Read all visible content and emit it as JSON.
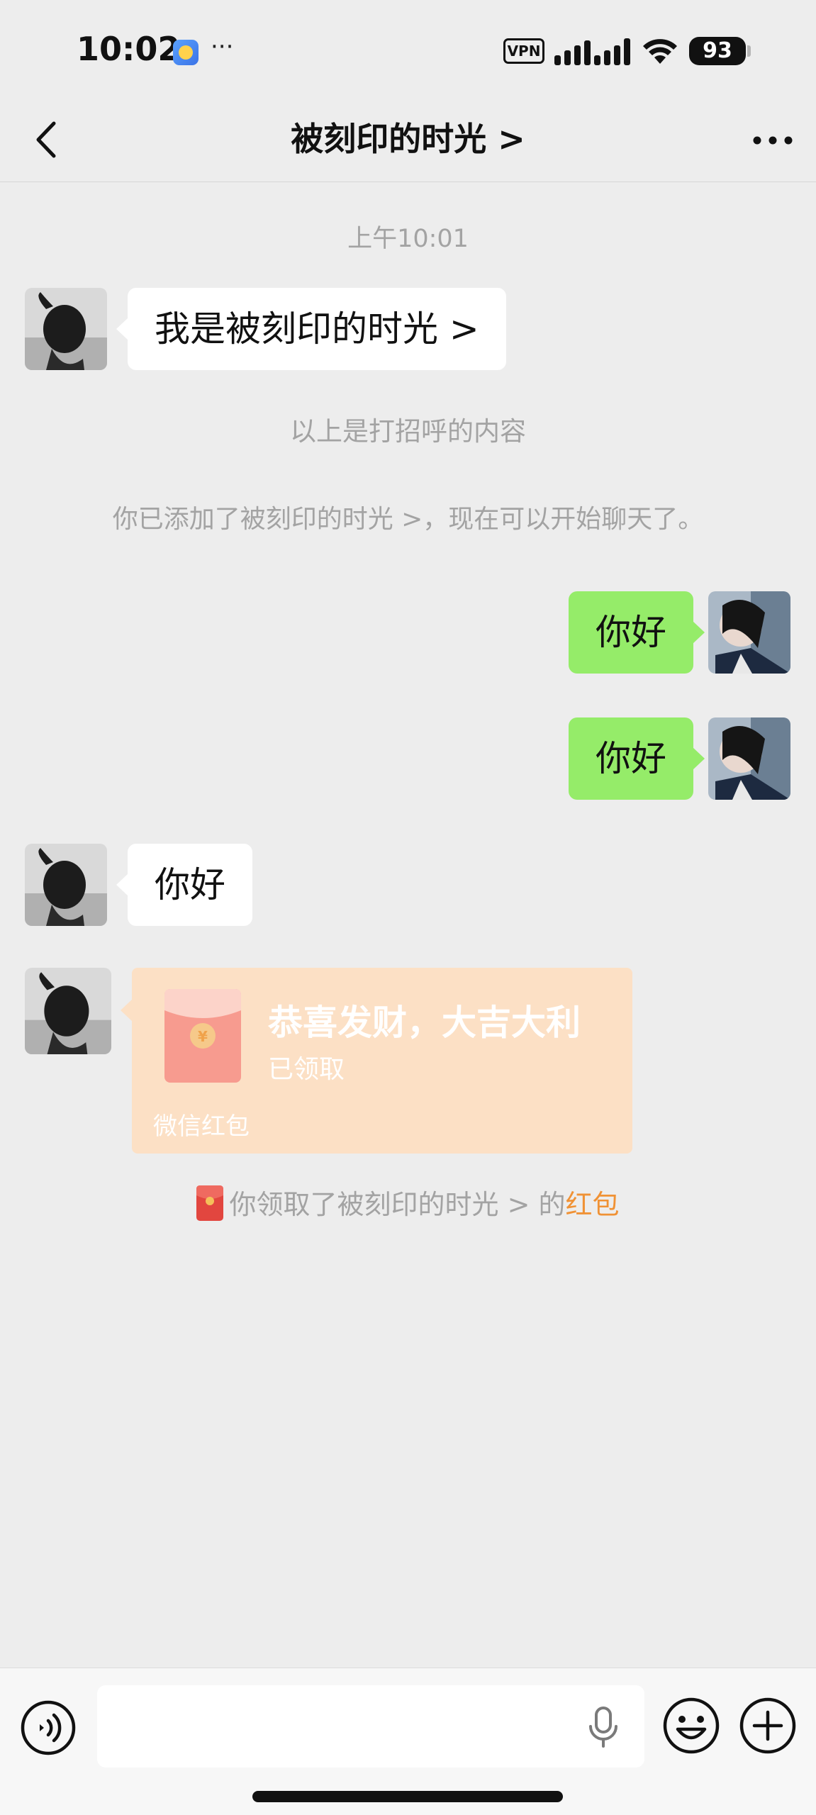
{
  "status_bar": {
    "time": "10:02",
    "dots": "···",
    "vpn": "VPN",
    "battery": "93",
    "icons": [
      "app-icon",
      "signal-icon",
      "wifi-icon",
      "battery-icon"
    ]
  },
  "nav": {
    "title": "被刻印的时光 >",
    "back_icon": "chevron-left-icon",
    "more_icon": "more-dots-icon"
  },
  "chat": {
    "timestamp": "上午10:01",
    "greeting_message": "我是被刻印的时光 >",
    "greeting_note": "以上是打招呼的内容",
    "added_note": "你已添加了被刻印的时光 >，现在可以开始聊天了。",
    "outgoing_1": "你好",
    "outgoing_2": "你好",
    "incoming_1": "你好",
    "red_packet": {
      "title": "恭喜发财，大吉大利",
      "status": "已领取",
      "footer": "微信红包"
    },
    "receive_notice": {
      "prefix": "你领取了被刻印的时光 > 的",
      "link": "红包"
    }
  },
  "input_bar": {
    "placeholder": "",
    "icons": [
      "voice-icon",
      "microphone-icon",
      "emoji-icon",
      "plus-icon"
    ]
  },
  "colors": {
    "background": "#ededed",
    "outgoing_bubble": "#95ec69",
    "incoming_bubble": "#ffffff",
    "red_packet_received": "#fce0c5",
    "link_orange": "#f09235",
    "system_text": "#a3a3a3"
  }
}
